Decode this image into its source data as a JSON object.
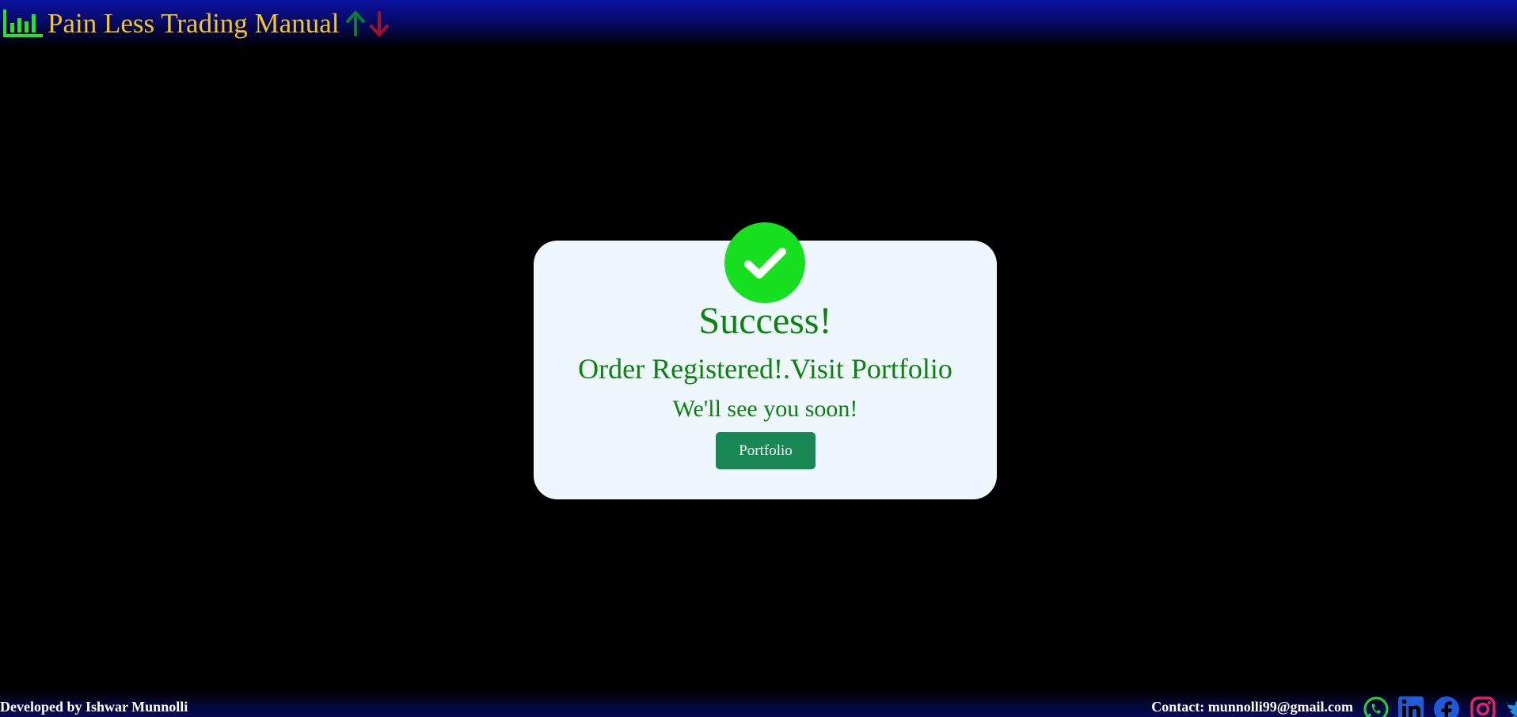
{
  "header": {
    "title": "Pain Less Trading Manual",
    "logo_icon": "bar-chart-icon",
    "up_arrow_icon": "arrow-up-icon",
    "down_arrow_icon": "arrow-down-icon"
  },
  "modal": {
    "icon": "check-circle-icon",
    "title": "Success!",
    "message": "Order Registered!.Visit Portfolio",
    "subtext": "We'll see you soon!",
    "button_label": "Portfolio"
  },
  "footer": {
    "credit": "Developed by Ishwar Munnolli",
    "contact": "Contact: munnolli99@gmail.com",
    "social_icons": [
      "whatsapp-icon",
      "linkedin-icon",
      "facebook-icon",
      "instagram-icon",
      "twitter-icon"
    ]
  },
  "colors": {
    "background": "#000000",
    "header_gradient_top": "#0b12a0",
    "brand_title": "#f3c61d",
    "logo_green": "#22e61f",
    "arrow_up": "#0f7a33",
    "arrow_down": "#a3102a",
    "card_background": "#eef6fe",
    "check_circle": "#16e01f",
    "success_text": "#0b830b",
    "button_background": "#198754",
    "button_text": "#ffffff",
    "footer_text": "#ffffff"
  }
}
